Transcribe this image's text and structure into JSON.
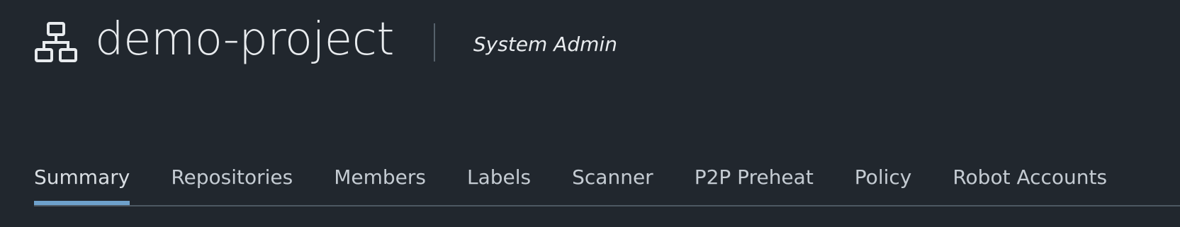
{
  "header": {
    "icon": "project-hierarchy-icon",
    "title": "demo-project",
    "role": "System Admin"
  },
  "tabs": [
    {
      "label": "Summary",
      "active": true
    },
    {
      "label": "Repositories",
      "active": false
    },
    {
      "label": "Members",
      "active": false
    },
    {
      "label": "Labels",
      "active": false
    },
    {
      "label": "Scanner",
      "active": false
    },
    {
      "label": "P2P Preheat",
      "active": false
    },
    {
      "label": "Policy",
      "active": false
    },
    {
      "label": "Robot Accounts",
      "active": false
    }
  ],
  "colors": {
    "background": "#21272e",
    "text": "#e8ebee",
    "tab_text": "#c4cbd2",
    "accent": "#6ea1cc",
    "divider": "#4d5862"
  }
}
